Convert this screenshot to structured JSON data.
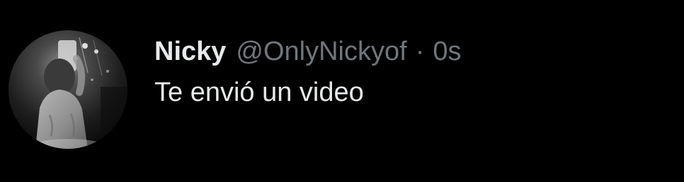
{
  "post": {
    "display_name": "Nicky",
    "handle": "@OnlyNickyof",
    "separator": "·",
    "timestamp": "0s",
    "text": "Te envió un video"
  },
  "avatar": {
    "icon": "profile-photo-avatar",
    "style": "grayscale"
  },
  "colors": {
    "background": "#000000",
    "primary_text": "#e7e9ea",
    "secondary_text": "#71767b"
  }
}
